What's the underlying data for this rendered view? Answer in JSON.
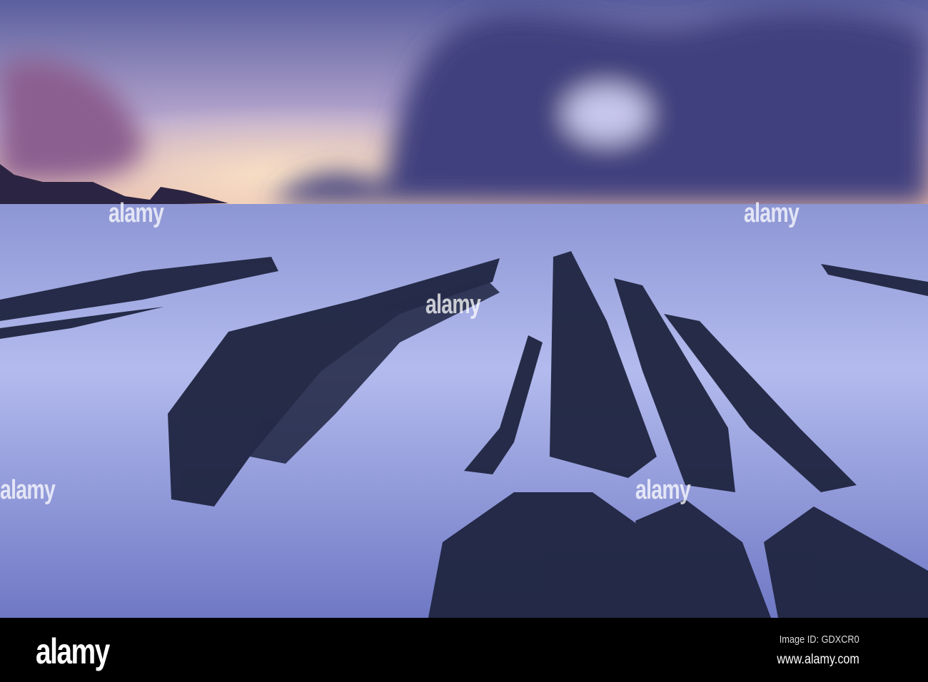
{
  "watermark": "alamy",
  "footer": {
    "logo": "alamy",
    "image_id": "Image ID: GDXCR0",
    "url": "www.alamy.com"
  },
  "colors": {
    "sky_top": "#4a4f8c",
    "glow": "#f4c8a8",
    "sea": "#8a93d6",
    "rock": "#1d2238"
  }
}
